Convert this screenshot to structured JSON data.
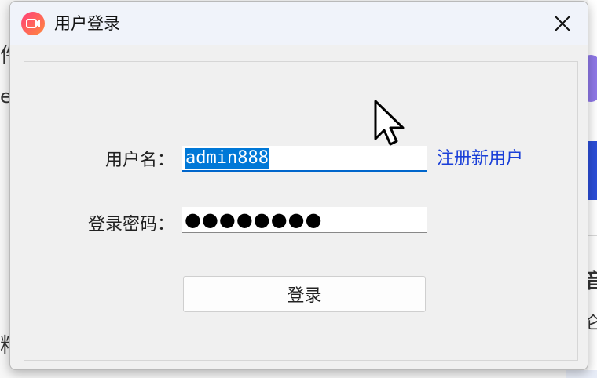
{
  "background": {
    "fragments": [
      "件",
      "er",
      "料",
      "音",
      "仑"
    ]
  },
  "window": {
    "title": "用户登录",
    "app_icon": "video-camera-icon",
    "close_icon": "close-icon"
  },
  "form": {
    "username_label": "用户名：",
    "username_value": "admin888",
    "register_link": "注册新用户",
    "password_label": "登录密码：",
    "password_mask": "●●●●●●●●",
    "login_button": "登录"
  },
  "colors": {
    "selection": "#0078d7",
    "link": "#1a3fd8",
    "icon_gradient_start": "#ff4d6d",
    "icon_gradient_end": "#ff8a3d"
  }
}
